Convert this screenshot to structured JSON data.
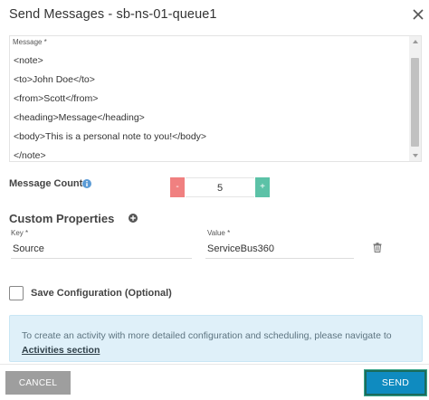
{
  "dialog": {
    "title": "Send Messages - sb-ns-01-queue1",
    "close_icon": "close-icon"
  },
  "message": {
    "label": "Message *",
    "lines": [
      "<note>",
      "<to>John Doe</to>",
      "<from>Scott</from>",
      "<heading>Message</heading>",
      "<body>This is a personal note to you!</body>",
      "</note>"
    ]
  },
  "message_count": {
    "label": "Message Count",
    "value": "5",
    "minus_label": "-",
    "plus_label": "+",
    "info_icon": "info-icon"
  },
  "custom_properties": {
    "title": "Custom Properties",
    "add_icon": "plus-circle-icon",
    "key_label": "Key *",
    "key_value": "Source",
    "value_label": "Value *",
    "value_value": "ServiceBus360",
    "delete_icon": "trash-icon"
  },
  "save_configuration": {
    "label": "Save Configuration (Optional)",
    "checked": false
  },
  "info_box": {
    "text": "To create an activity with more detailed configuration and scheduling, please navigate to ",
    "link_text": "Activities section"
  },
  "footer": {
    "cancel_label": "CANCEL",
    "send_label": "SEND"
  },
  "colors": {
    "minus_button": "#f08080",
    "plus_button": "#5cc2a7",
    "send_button": "#0f8bc0",
    "cancel_button": "#9e9e9e",
    "info_background": "#dff0f9"
  }
}
